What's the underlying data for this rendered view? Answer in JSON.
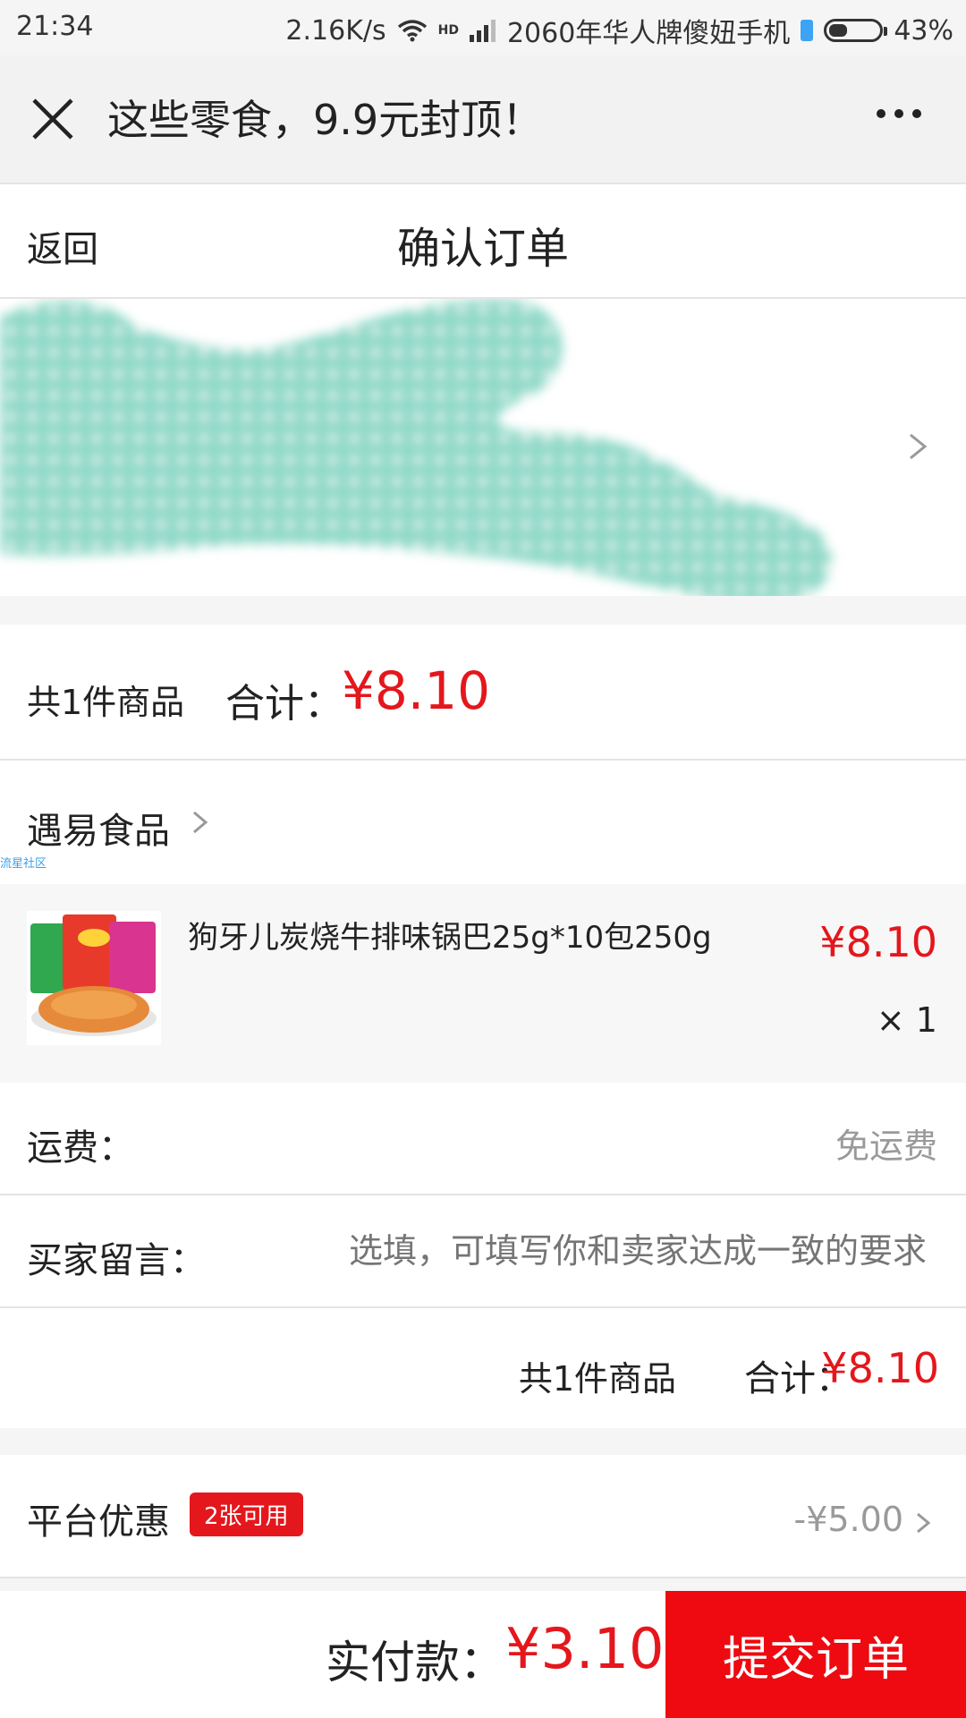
{
  "status_bar": {
    "time": "21:34",
    "network_speed": "2.16K/s",
    "signal_label": "HD",
    "carrier": "2060年华人牌傻妞手机",
    "battery": "43%",
    "battery_level": 0.43
  },
  "app_bar": {
    "title": "这些零食，9.9元封顶！",
    "close_icon": "close-icon",
    "more_icon": "more-icon"
  },
  "page_header": {
    "back_label": "返回",
    "title": "确认订单"
  },
  "order_summary": {
    "item_count": "共1件商品",
    "total_label": "合计：",
    "total_price": "¥8.10"
  },
  "shop": {
    "name": "遇易食品",
    "tag": "流星社区"
  },
  "product": {
    "name": "狗牙儿炭烧牛排味锅巴25g*10包250g",
    "price": "¥8.10",
    "quantity": "× 1"
  },
  "shipping": {
    "label": "运费：",
    "value": "免运费"
  },
  "message": {
    "label": "买家留言：",
    "placeholder": "选填，可填写你和卖家达成一致的要求"
  },
  "subtotal": {
    "item_count": "共1件商品",
    "total_label": "合计：",
    "total_price": "¥8.10"
  },
  "promo": {
    "label": "平台优惠",
    "badge": "2张可用",
    "value": "-¥5.00"
  },
  "bottom_bar": {
    "pay_label": "实付款：",
    "pay_amount": "¥3.10",
    "submit_label": "提交订单"
  },
  "colors": {
    "accent_red": "#e4171c",
    "submit_red": "#ee0a10",
    "redaction_teal": "#8fd9c8"
  }
}
